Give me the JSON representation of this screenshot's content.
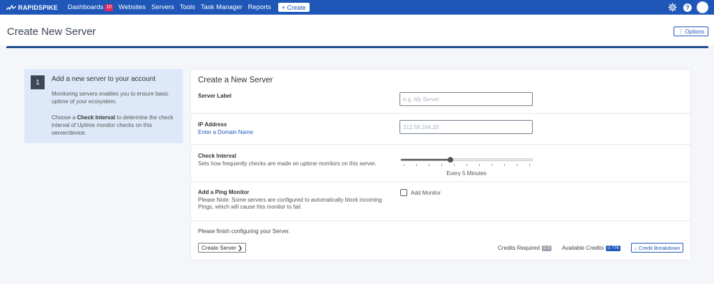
{
  "nav": {
    "logo": "RAPIDSPIKE",
    "items": [
      {
        "label": "Dashboards",
        "badge": "10"
      },
      {
        "label": "Websites"
      },
      {
        "label": "Servers"
      },
      {
        "label": "Tools"
      },
      {
        "label": "Task Manager"
      },
      {
        "label": "Reports"
      }
    ],
    "create_label": "+ Create",
    "help_label": "?"
  },
  "page": {
    "title": "Create New Server",
    "options_label": "⋮ Options"
  },
  "info": {
    "step": "1",
    "title": "Add a new server to your account",
    "para1": "Monitoring servers enables you to ensure basic uptime of your ecosystem.",
    "para2_pre": "Choose a ",
    "para2_bold": "Check Interval",
    "para2_post": " to determine the check interval of Uptime monitor checks on this server/device."
  },
  "form": {
    "title": "Create a New Server",
    "server_label": {
      "label": "Server Label",
      "placeholder": "e.g. My Server",
      "value": ""
    },
    "ip_address": {
      "label": "IP Address",
      "link": "Enter a Domain Name",
      "placeholder": "212.58.244.20",
      "value": ""
    },
    "check_interval": {
      "label": "Check Interval",
      "desc": "Sets how frequently checks are made on uptime monitors on this server.",
      "value_label": "Every 5 Minutes",
      "position_fraction": 0.38,
      "ticks": 11
    },
    "ping_monitor": {
      "label": "Add a Ping Monitor",
      "desc": "Please Note: Some servers are configured to automatically block incoming Pings, which will cause this monitor to fail.",
      "checkbox_label": "Add Monitor",
      "checked": false
    },
    "footer_msg": "Please finish configuring your Server.",
    "create_button": "Create Server ❯",
    "credits_required_label": "Credits Required",
    "credits_required_value": "⊙ 0",
    "available_credits_label": "Available Credits",
    "available_credits_value": "⊙ 776",
    "breakdown_button": "↓ Credit Breakdown"
  },
  "colors": {
    "primary": "#1f57b9",
    "nav_bg": "#1f57b9",
    "info_bg": "#dde9f8",
    "badge_red": "#e0245e"
  }
}
